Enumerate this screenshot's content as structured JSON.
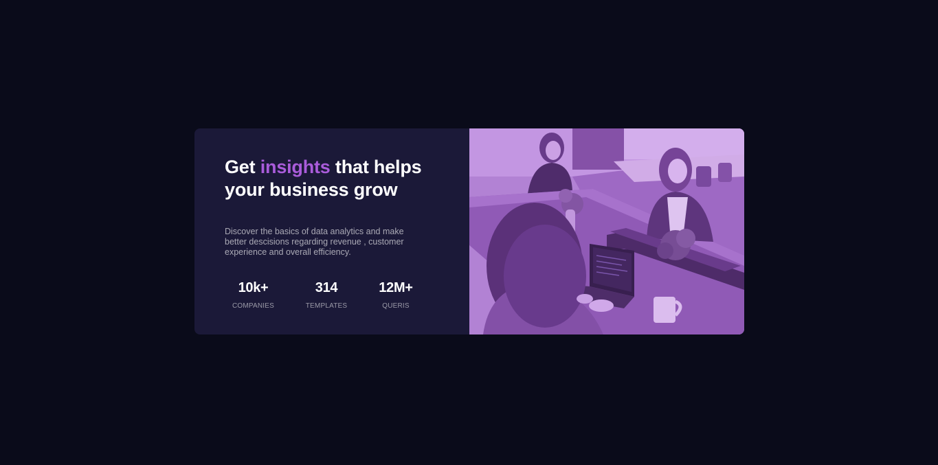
{
  "card": {
    "headline": {
      "prefix": "Get ",
      "accent": "insights",
      "suffix": " that helps your business grow"
    },
    "description": "Discover the basics of data analytics and make better descisions regarding revenue , customer experience and overall efficiency.",
    "stats": [
      {
        "value": "10k+",
        "label": "COMPANIES"
      },
      {
        "value": "314",
        "label": "TEMPLATES"
      },
      {
        "value": "12M+",
        "label": "QUERIS"
      }
    ]
  },
  "image": {
    "subject": "people-working-in-office-photo",
    "tint_color": "#aa5cdb"
  },
  "colors": {
    "page_background": "#0a0b1a",
    "card_background": "#1b1938",
    "accent": "#aa5cdb",
    "text_primary": "#ffffff"
  }
}
